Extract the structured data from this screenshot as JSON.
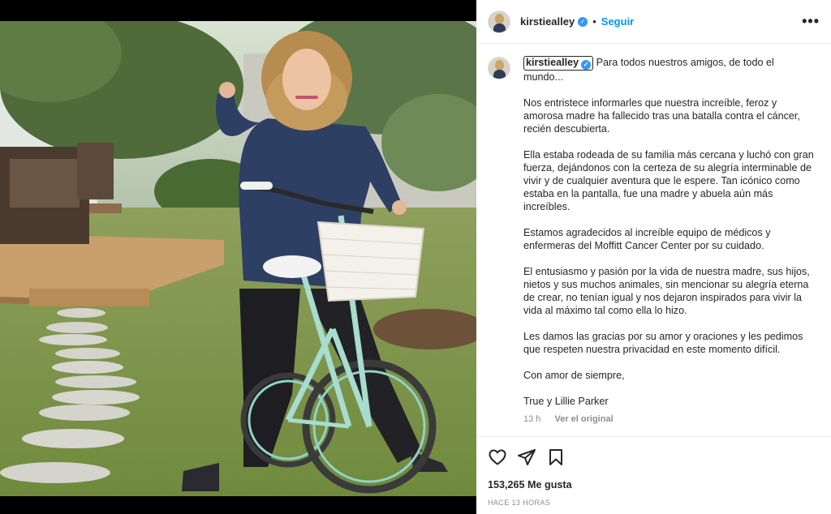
{
  "post": {
    "username": "kirstiealley",
    "follow_label": "Seguir",
    "more_label": "•••",
    "verified_glyph": "✓"
  },
  "caption": {
    "first_line": "Para todos nuestros amigos, de todo el mundo...",
    "paragraphs": [
      "Nos entristece informarles que nuestra increíble, feroz y amorosa madre ha fallecido tras una batalla contra el cáncer, recién descubierta.",
      "Ella estaba rodeada de su familia más cercana y luchó con gran fuerza, dejándonos con la certeza de su alegría interminable de vivir y de cualquier aventura que le espere. Tan icónico como estaba en la pantalla, fue una madre y abuela aún más increíbles.",
      "Estamos agradecidos al increíble equipo de médicos y enfermeras del Moffitt Cancer Center por su cuidado.",
      "El entusiasmo y pasión por la vida de nuestra madre, sus hijos, nietos y sus muchos animales, sin mencionar su alegría eterna de crear, no tenían igual y nos dejaron inspirados para vivir la vida al máximo tal como ella lo hizo.",
      "Les damos las gracias por su amor y oraciones y les pedimos que respeten nuestra privacidad en este momento difícil.",
      "Con amor de siempre,",
      "True y Lillie Parker"
    ],
    "age": "13 h",
    "see_original": "Ver el original"
  },
  "actions": {
    "icons": [
      "heart-icon",
      "share-icon",
      "bookmark-icon"
    ],
    "likes": "153,265 Me gusta",
    "timestamp": "HACE 13 HORAS"
  },
  "colors": {
    "accent": "#0095f6",
    "verified": "#3897f0",
    "text": "#262626",
    "muted": "#8e8e8e"
  }
}
